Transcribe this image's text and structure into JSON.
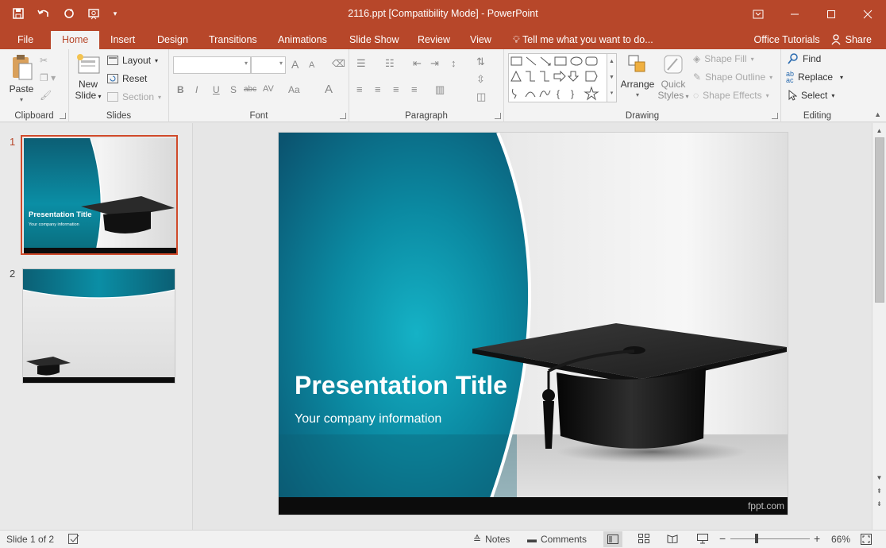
{
  "window": {
    "title": "2116.ppt [Compatibility Mode] - PowerPoint"
  },
  "qat": {
    "save_icon": "save-icon",
    "undo_icon": "undo-icon",
    "redo_icon": "redo-icon",
    "present_icon": "present-from-beginning-icon"
  },
  "tabs": {
    "file": "File",
    "home": "Home",
    "insert": "Insert",
    "design": "Design",
    "transitions": "Transitions",
    "animations": "Animations",
    "slideshow": "Slide Show",
    "review": "Review",
    "view": "View",
    "tellme": "Tell me what you want to do...",
    "office_tutorials": "Office Tutorials",
    "share": "Share"
  },
  "ribbon": {
    "clipboard": {
      "label": "Clipboard",
      "paste": "Paste"
    },
    "slides": {
      "label": "Slides",
      "new_slide_1": "New",
      "new_slide_2": "Slide",
      "layout": "Layout",
      "reset": "Reset",
      "section": "Section"
    },
    "font": {
      "label": "Font",
      "bold": "B",
      "italic": "I",
      "underline": "U",
      "shadow": "S",
      "strike": "abc",
      "spacing": "AV",
      "case": "Aa",
      "color": "A",
      "grow": "A",
      "shrink": "A"
    },
    "paragraph": {
      "label": "Paragraph"
    },
    "drawing": {
      "label": "Drawing",
      "arrange": "Arrange",
      "quick_styles_1": "Quick",
      "quick_styles_2": "Styles",
      "shape_fill": "Shape Fill",
      "shape_outline": "Shape Outline",
      "shape_effects": "Shape Effects"
    },
    "editing": {
      "label": "Editing",
      "find": "Find",
      "replace": "Replace",
      "select": "Select"
    }
  },
  "slides": [
    {
      "number": "1",
      "title": "Presentation Title",
      "subtitle": "Your company information",
      "selected": true
    },
    {
      "number": "2",
      "selected": false
    }
  ],
  "main_slide": {
    "title": "Presentation Title",
    "subtitle": "Your company information",
    "footer": "fppt.com"
  },
  "status": {
    "slide_info": "Slide 1 of 2",
    "notes": "Notes",
    "comments": "Comments",
    "zoom": "66%"
  },
  "colors": {
    "accent": "#b7472a",
    "slide_teal": "#0d7f94"
  }
}
